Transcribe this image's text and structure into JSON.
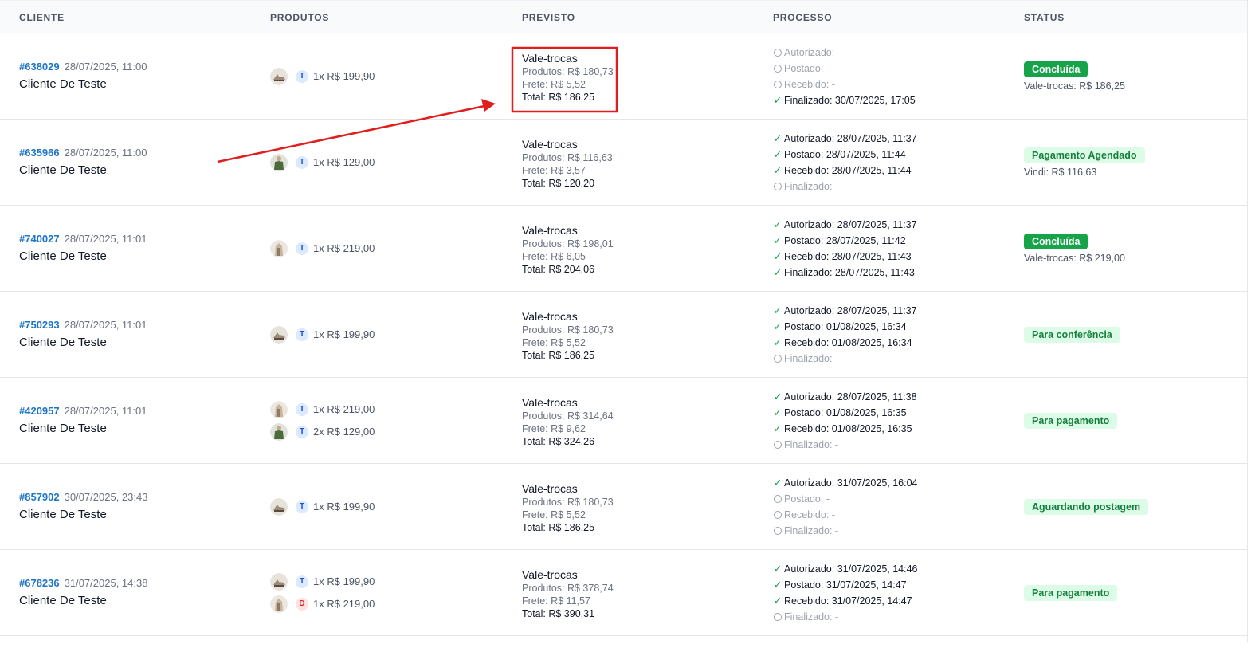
{
  "headers": {
    "client": "CLIENTE",
    "products": "PRODUTOS",
    "forecast": "PREVISTO",
    "process": "PROCESSO",
    "status": "STATUS"
  },
  "rows": [
    {
      "order_id": "#638029",
      "date": "28/07/2025, 11:00",
      "client": "Cliente De Teste",
      "products": [
        {
          "letter": "T",
          "letter_type": "t",
          "thumb": "cream-shoe",
          "text": "1x R$ 199,90"
        }
      ],
      "forecast": {
        "title": "Vale-trocas",
        "products": "Produtos: R$ 180,73",
        "freight": "Frete: R$ 5,52",
        "total": "Total: R$ 186,25"
      },
      "process": [
        {
          "state": "pending",
          "text": "Autorizado: -"
        },
        {
          "state": "pending",
          "text": "Postado: -"
        },
        {
          "state": "pending",
          "text": "Recebido: -"
        },
        {
          "state": "done",
          "text": "Finalizado: 30/07/2025, 17:05"
        }
      ],
      "status": {
        "label": "Concluída",
        "style": "solid",
        "note": "Vale-trocas: R$ 186,25"
      }
    },
    {
      "order_id": "#635966",
      "date": "28/07/2025, 11:00",
      "client": "Cliente De Teste",
      "products": [
        {
          "letter": "T",
          "letter_type": "t",
          "thumb": "green-jacket",
          "text": "1x R$ 129,00"
        }
      ],
      "forecast": {
        "title": "Vale-trocas",
        "products": "Produtos: R$ 116,63",
        "freight": "Frete: R$ 3,57",
        "total": "Total: R$ 120,20"
      },
      "process": [
        {
          "state": "done",
          "text": "Autorizado: 28/07/2025, 11:37"
        },
        {
          "state": "done",
          "text": "Postado: 28/07/2025, 11:44"
        },
        {
          "state": "done",
          "text": "Recebido: 28/07/2025, 11:44"
        },
        {
          "state": "pending",
          "text": "Finalizado: -"
        }
      ],
      "status": {
        "label": "Pagamento Agendado",
        "style": "soft",
        "note": "Vindi: R$ 116,63"
      }
    },
    {
      "order_id": "#740027",
      "date": "28/07/2025, 11:01",
      "client": "Cliente De Teste",
      "products": [
        {
          "letter": "T",
          "letter_type": "t",
          "thumb": "beige-model",
          "text": "1x R$ 219,00"
        }
      ],
      "forecast": {
        "title": "Vale-trocas",
        "products": "Produtos: R$ 198,01",
        "freight": "Frete: R$ 6,05",
        "total": "Total: R$ 204,06"
      },
      "process": [
        {
          "state": "done",
          "text": "Autorizado: 28/07/2025, 11:37"
        },
        {
          "state": "done",
          "text": "Postado: 28/07/2025, 11:42"
        },
        {
          "state": "done",
          "text": "Recebido: 28/07/2025, 11:43"
        },
        {
          "state": "done",
          "text": "Finalizado: 28/07/2025, 11:43"
        }
      ],
      "status": {
        "label": "Concluída",
        "style": "solid",
        "note": "Vale-trocas: R$ 219,00"
      }
    },
    {
      "order_id": "#750293",
      "date": "28/07/2025, 11:01",
      "client": "Cliente De Teste",
      "products": [
        {
          "letter": "T",
          "letter_type": "t",
          "thumb": "cream-shoe",
          "text": "1x R$ 199,90"
        }
      ],
      "forecast": {
        "title": "Vale-trocas",
        "products": "Produtos: R$ 180,73",
        "freight": "Frete: R$ 5,52",
        "total": "Total: R$ 186,25"
      },
      "process": [
        {
          "state": "done",
          "text": "Autorizado: 28/07/2025, 11:37"
        },
        {
          "state": "done",
          "text": "Postado: 01/08/2025, 16:34"
        },
        {
          "state": "done",
          "text": "Recebido: 01/08/2025, 16:34"
        },
        {
          "state": "pending",
          "text": "Finalizado: -"
        }
      ],
      "status": {
        "label": "Para conferência",
        "style": "soft",
        "note": ""
      }
    },
    {
      "order_id": "#420957",
      "date": "28/07/2025, 11:01",
      "client": "Cliente De Teste",
      "products": [
        {
          "letter": "T",
          "letter_type": "t",
          "thumb": "beige-model",
          "text": "1x R$ 219,00"
        },
        {
          "letter": "T",
          "letter_type": "t",
          "thumb": "green-jacket",
          "text": "2x R$ 129,00"
        }
      ],
      "forecast": {
        "title": "Vale-trocas",
        "products": "Produtos: R$ 314,64",
        "freight": "Frete: R$ 9,62",
        "total": "Total: R$ 324,26"
      },
      "process": [
        {
          "state": "done",
          "text": "Autorizado: 28/07/2025, 11:38"
        },
        {
          "state": "done",
          "text": "Postado: 01/08/2025, 16:35"
        },
        {
          "state": "done",
          "text": "Recebido: 01/08/2025, 16:35"
        },
        {
          "state": "pending",
          "text": "Finalizado: -"
        }
      ],
      "status": {
        "label": "Para pagamento",
        "style": "soft",
        "note": ""
      }
    },
    {
      "order_id": "#857902",
      "date": "30/07/2025, 23:43",
      "client": "Cliente De Teste",
      "products": [
        {
          "letter": "T",
          "letter_type": "t",
          "thumb": "cream-shoe",
          "text": "1x R$ 199,90"
        }
      ],
      "forecast": {
        "title": "Vale-trocas",
        "products": "Produtos: R$ 180,73",
        "freight": "Frete: R$ 5,52",
        "total": "Total: R$ 186,25"
      },
      "process": [
        {
          "state": "done",
          "text": "Autorizado: 31/07/2025, 16:04"
        },
        {
          "state": "pending",
          "text": "Postado: -"
        },
        {
          "state": "pending",
          "text": "Recebido: -"
        },
        {
          "state": "pending",
          "text": "Finalizado: -"
        }
      ],
      "status": {
        "label": "Aguardando postagem",
        "style": "soft",
        "note": ""
      }
    },
    {
      "order_id": "#678236",
      "date": "31/07/2025, 14:38",
      "client": "Cliente De Teste",
      "products": [
        {
          "letter": "T",
          "letter_type": "t",
          "thumb": "cream-shoe",
          "text": "1x R$ 199,90"
        },
        {
          "letter": "D",
          "letter_type": "d",
          "thumb": "beige-model",
          "text": "1x R$ 219,00"
        }
      ],
      "forecast": {
        "title": "Vale-trocas",
        "products": "Produtos: R$ 378,74",
        "freight": "Frete: R$ 11,57",
        "total": "Total: R$ 390,31"
      },
      "process": [
        {
          "state": "done",
          "text": "Autorizado: 31/07/2025, 14:46"
        },
        {
          "state": "done",
          "text": "Postado: 31/07/2025, 14:47"
        },
        {
          "state": "done",
          "text": "Recebido: 31/07/2025, 14:47"
        },
        {
          "state": "pending",
          "text": "Finalizado: -"
        }
      ],
      "status": {
        "label": "Para pagamento",
        "style": "soft",
        "note": ""
      }
    }
  ],
  "annotation": {
    "color": "#e11d1d",
    "highlight_row": 0,
    "arrow_icon": "red-arrow-icon",
    "box_icon": "red-highlight-box"
  }
}
